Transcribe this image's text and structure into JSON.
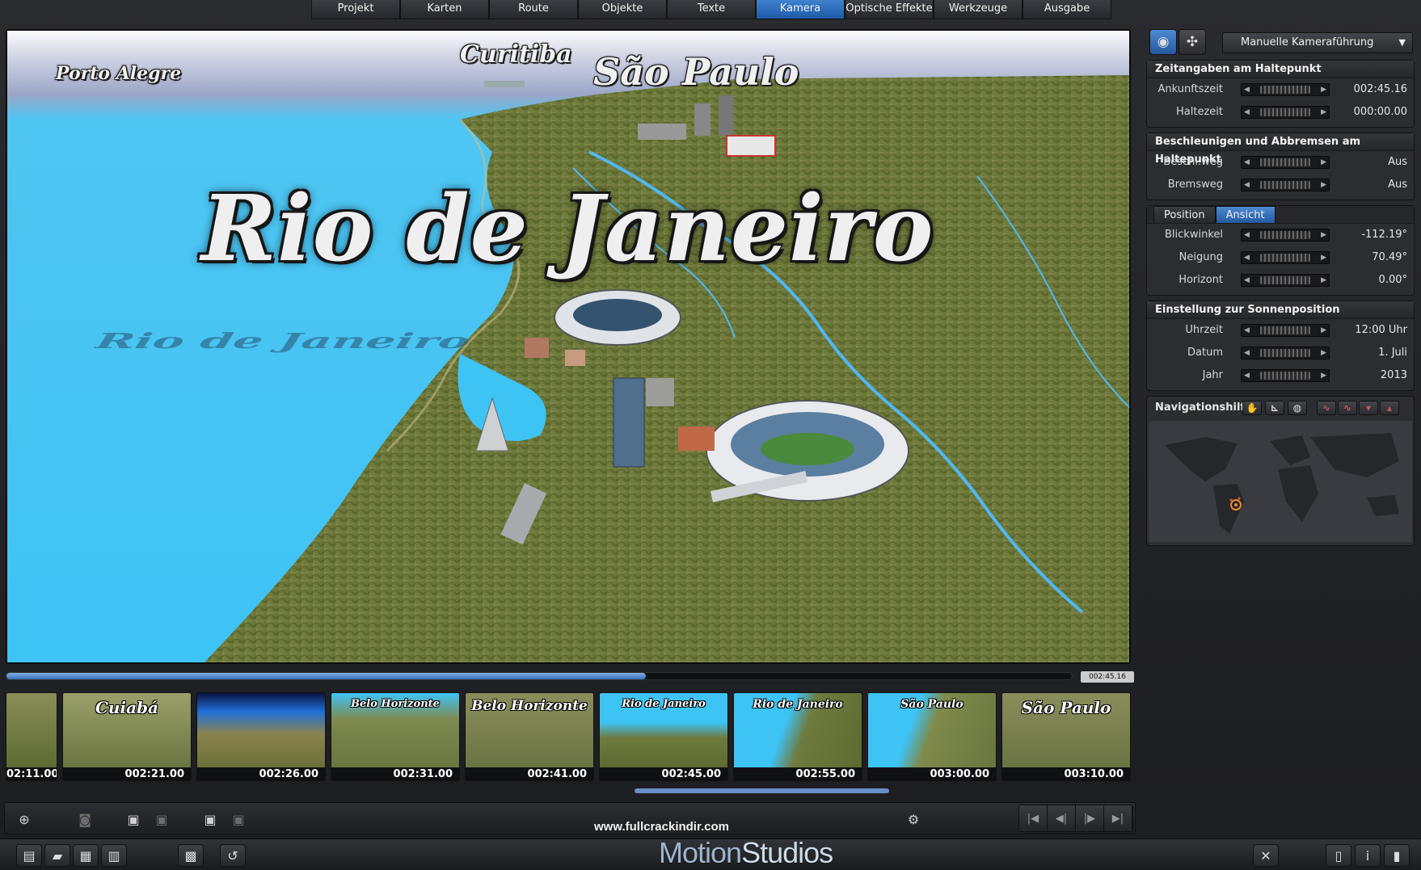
{
  "menu": [
    "Projekt",
    "Karten",
    "Route",
    "Objekte",
    "Texte",
    "Kamera",
    "Optische Effekte",
    "Werkzeuge",
    "Ausgabe"
  ],
  "menu_active": "Kamera",
  "viewport": {
    "labels": {
      "porto_alegre": "Porto Alegre",
      "curitiba": "Curitiba",
      "sao_paulo": "São Paulo",
      "rio": "Rio de Janeiro",
      "rio_reflection": "Rio de Janeiro"
    }
  },
  "timeline": {
    "progress": 0.6,
    "time": "002:45.16"
  },
  "thumbnails": [
    {
      "title": "",
      "time": "02:11.00"
    },
    {
      "title": "Cuiabá",
      "time": "002:21.00"
    },
    {
      "title": "",
      "time": "002:26.00"
    },
    {
      "title": "Belo Horizonte",
      "time": "002:31.00"
    },
    {
      "title": "Belo Horizonte",
      "time": "002:41.00"
    },
    {
      "title": "Rio de Janeiro",
      "time": "002:45.00"
    },
    {
      "title": "Rio de Janeiro",
      "time": "002:55.00"
    },
    {
      "title": "São Paulo",
      "time": "003:00.00"
    },
    {
      "title": "São Paulo",
      "time": "003:10.00"
    }
  ],
  "website": "www.fullcrackindir.com",
  "brand": {
    "part1": "Motion",
    "part2": "Studios"
  },
  "camera": {
    "mode": "Manuelle Kameraführung"
  },
  "panel": {
    "timing": {
      "title": "Zeitangaben am Haltepunkt",
      "rows": [
        {
          "label": "Ankunftszeit",
          "value": "002:45.16"
        },
        {
          "label": "Haltezeit",
          "value": "000:00.00"
        }
      ]
    },
    "accel": {
      "title": "Beschleunigen und Abbremsen am Haltepunkt",
      "rows": [
        {
          "label": "Beschl.weg",
          "value": "Aus"
        },
        {
          "label": "Bremsweg",
          "value": "Aus"
        }
      ]
    },
    "view": {
      "tab_position": "Position",
      "tab_view": "Ansicht",
      "rows": [
        {
          "label": "Blickwinkel",
          "value": "-112.19°"
        },
        {
          "label": "Neigung",
          "value": "70.49°"
        },
        {
          "label": "Horizont",
          "value": "0.00°"
        }
      ]
    },
    "sun": {
      "title": "Einstellung zur Sonnenposition",
      "rows": [
        {
          "label": "Uhrzeit",
          "value": "12:00 Uhr"
        },
        {
          "label": "Datum",
          "value": "1. Juli"
        },
        {
          "label": "Jahr",
          "value": "2013"
        }
      ]
    },
    "nav": {
      "title": "Navigationshilfe"
    }
  },
  "colors": {
    "accent": "#2f6fbe",
    "water": "#3ec3f5",
    "land": "#6e7a3c"
  }
}
